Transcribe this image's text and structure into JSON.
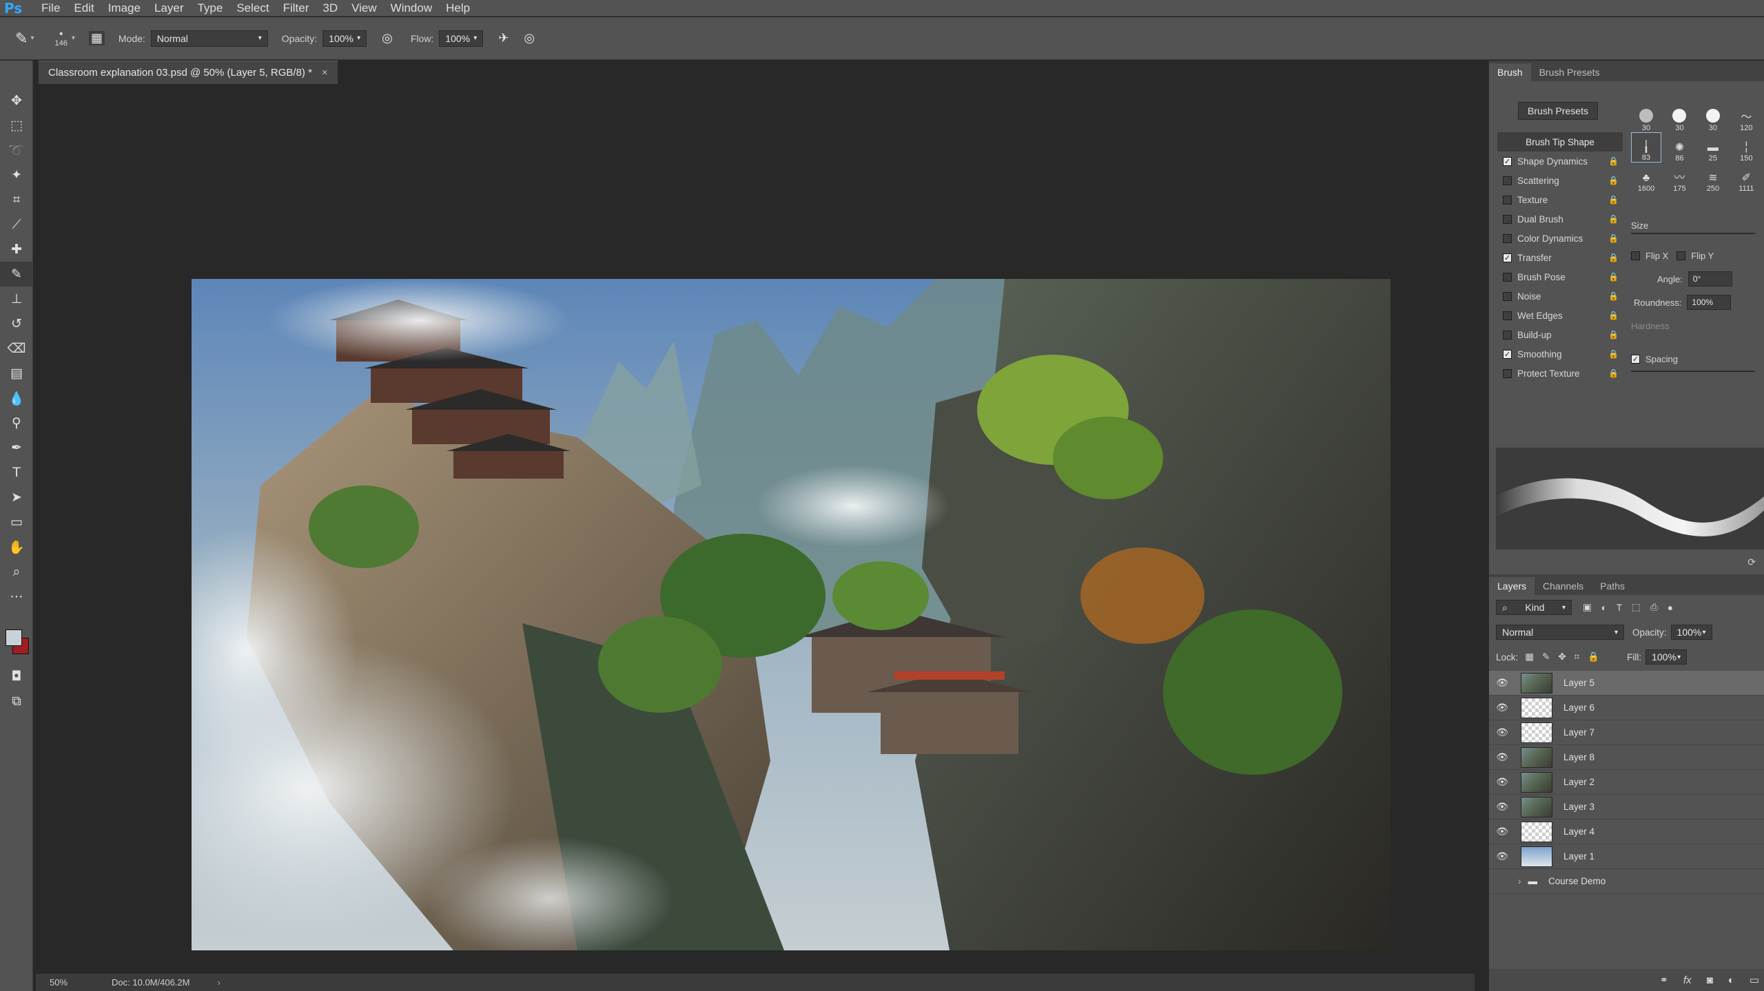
{
  "app": {
    "logo": "Ps"
  },
  "menu": [
    "File",
    "Edit",
    "Image",
    "Layer",
    "Type",
    "Select",
    "Filter",
    "3D",
    "View",
    "Window",
    "Help"
  ],
  "options": {
    "brush_size": "146",
    "mode_label": "Mode:",
    "mode_value": "Normal",
    "opacity_label": "Opacity:",
    "opacity_value": "100%",
    "flow_label": "Flow:",
    "flow_value": "100%"
  },
  "document": {
    "tab_title": "Classroom explanation 03.psd @ 50% (Layer 5, RGB/8) *",
    "close_glyph": "×"
  },
  "status": {
    "zoom": "50%",
    "doc_size": "Doc: 10.0M/406.2M"
  },
  "brush_panel": {
    "tabs": [
      "Brush",
      "Brush Presets"
    ],
    "presets_button": "Brush Presets",
    "options": [
      {
        "label": "Brush Tip Shape",
        "header": true
      },
      {
        "label": "Shape Dynamics",
        "checked": true
      },
      {
        "label": "Scattering",
        "checked": false
      },
      {
        "label": "Texture",
        "checked": false
      },
      {
        "label": "Dual Brush",
        "checked": false
      },
      {
        "label": "Color Dynamics",
        "checked": false
      },
      {
        "label": "Transfer",
        "checked": true
      },
      {
        "label": "Brush Pose",
        "checked": false
      },
      {
        "label": "Noise",
        "checked": false
      },
      {
        "label": "Wet Edges",
        "checked": false
      },
      {
        "label": "Build-up",
        "checked": false
      },
      {
        "label": "Smoothing",
        "checked": true
      },
      {
        "label": "Protect Texture",
        "checked": false
      }
    ],
    "tip_sizes": [
      "30",
      "30",
      "30",
      "120",
      "83",
      "86",
      "25",
      "150",
      "1600",
      "175",
      "250",
      "1111"
    ],
    "size_label": "Size",
    "flip_x": "Flip X",
    "flip_y": "Flip Y",
    "angle_label": "Angle:",
    "angle_value": "0°",
    "roundness_label": "Roundness:",
    "roundness_value": "100%",
    "hardness_label": "Hardness",
    "spacing_label": "Spacing"
  },
  "layers_panel": {
    "tabs": [
      "Layers",
      "Channels",
      "Paths"
    ],
    "kind_label": "Kind",
    "blend_mode": "Normal",
    "opacity_label": "Opacity:",
    "opacity_value": "100%",
    "lock_label": "Lock:",
    "fill_label": "Fill:",
    "fill_value": "100%",
    "layers": [
      {
        "name": "Layer 5",
        "selected": true,
        "thumb": "img"
      },
      {
        "name": "Layer 6",
        "selected": false,
        "thumb": "checker"
      },
      {
        "name": "Layer 7",
        "selected": false,
        "thumb": "checker"
      },
      {
        "name": "Layer 8",
        "selected": false,
        "thumb": "img"
      },
      {
        "name": "Layer 2",
        "selected": false,
        "thumb": "img"
      },
      {
        "name": "Layer 3",
        "selected": false,
        "thumb": "img"
      },
      {
        "name": "Layer 4",
        "selected": false,
        "thumb": "checker"
      },
      {
        "name": "Layer 1",
        "selected": false,
        "thumb": "img"
      }
    ],
    "group_name": "Course Demo",
    "footer_fx": "fx"
  },
  "colors": {
    "foreground": "#c9d2d9",
    "background": "#a01d24",
    "accent": "#31a8ff"
  }
}
